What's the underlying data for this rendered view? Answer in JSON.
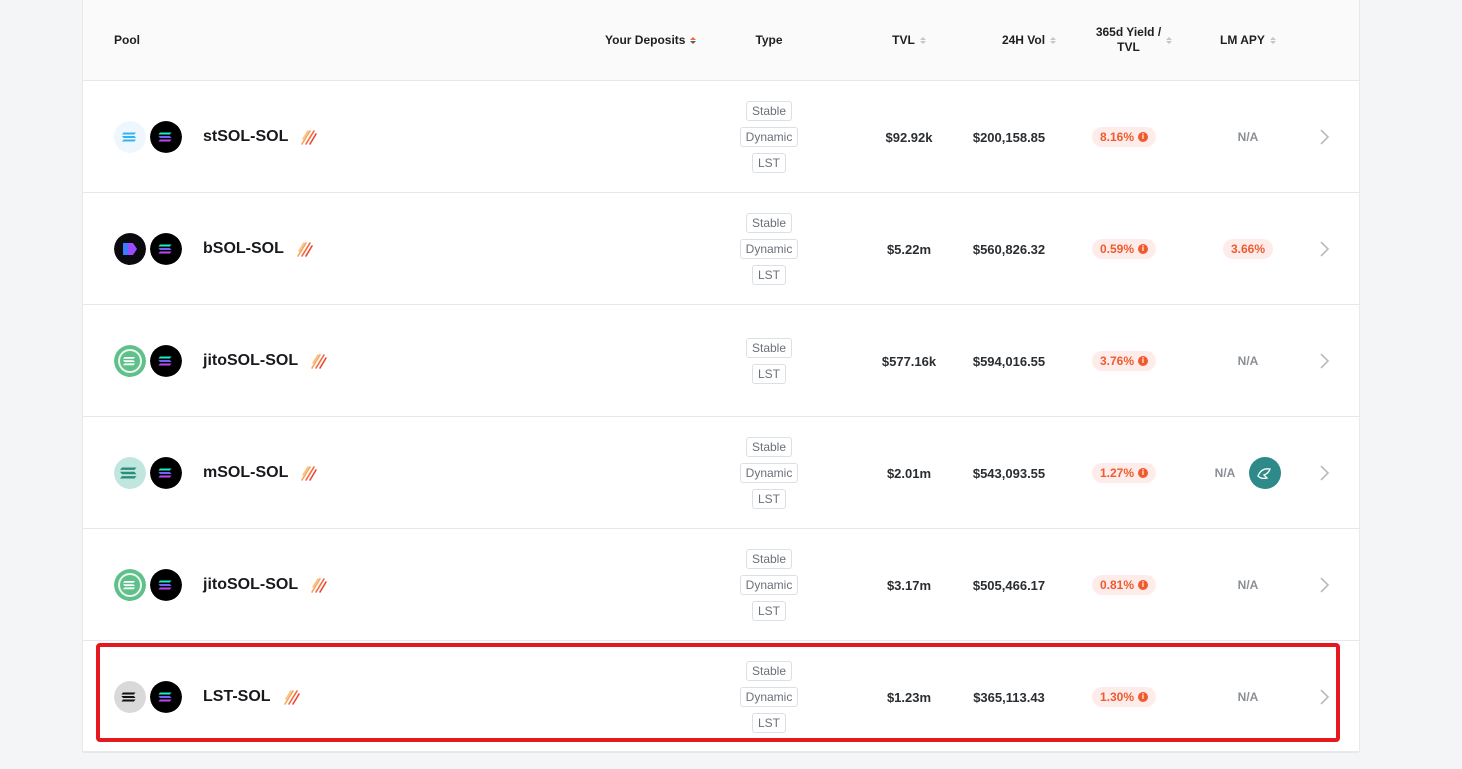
{
  "header": {
    "pool": "Pool",
    "your_deposits": "Your Deposits",
    "type": "Type",
    "tvl": "TVL",
    "vol_24h": "24H Vol",
    "yield_line1": "365d Yield /",
    "yield_line2": "TVL",
    "lm_apy": "LM APY"
  },
  "colors": {
    "accent": "#ef5b2e",
    "highlight": "#e5171f",
    "token_dark": "#000000",
    "token_teal": "#2e8a88"
  },
  "rows": [
    {
      "name": "stSOL-SOL",
      "token_a_icon": "stsol-icon",
      "types": [
        "Stable",
        "Dynamic",
        "LST"
      ],
      "tvl": "$92.92k",
      "vol": "$200,158.85",
      "yield": "8.16%",
      "lm": "N/A"
    },
    {
      "name": "bSOL-SOL",
      "token_a_icon": "bsol-icon",
      "types": [
        "Stable",
        "Dynamic",
        "LST"
      ],
      "tvl": "$5.22m",
      "vol": "$560,826.32",
      "yield": "0.59%",
      "lm": "3.66%"
    },
    {
      "name": "jitoSOL-SOL",
      "token_a_icon": "jitosol-icon",
      "types": [
        "Stable",
        "LST"
      ],
      "tvl": "$577.16k",
      "vol": "$594,016.55",
      "yield": "3.76%",
      "lm": "N/A"
    },
    {
      "name": "mSOL-SOL",
      "token_a_icon": "msol-icon",
      "types": [
        "Stable",
        "Dynamic",
        "LST"
      ],
      "tvl": "$2.01m",
      "vol": "$543,093.55",
      "yield": "1.27%",
      "lm": "N/A"
    },
    {
      "name": "jitoSOL-SOL",
      "token_a_icon": "jitosol-icon",
      "types": [
        "Stable",
        "Dynamic",
        "LST"
      ],
      "tvl": "$3.17m",
      "vol": "$505,466.17",
      "yield": "0.81%",
      "lm": "N/A"
    },
    {
      "name": "LST-SOL",
      "token_a_icon": "lst-icon",
      "types": [
        "Stable",
        "Dynamic",
        "LST"
      ],
      "tvl": "$1.23m",
      "vol": "$365,113.43",
      "yield": "1.30%",
      "lm": "N/A"
    }
  ]
}
